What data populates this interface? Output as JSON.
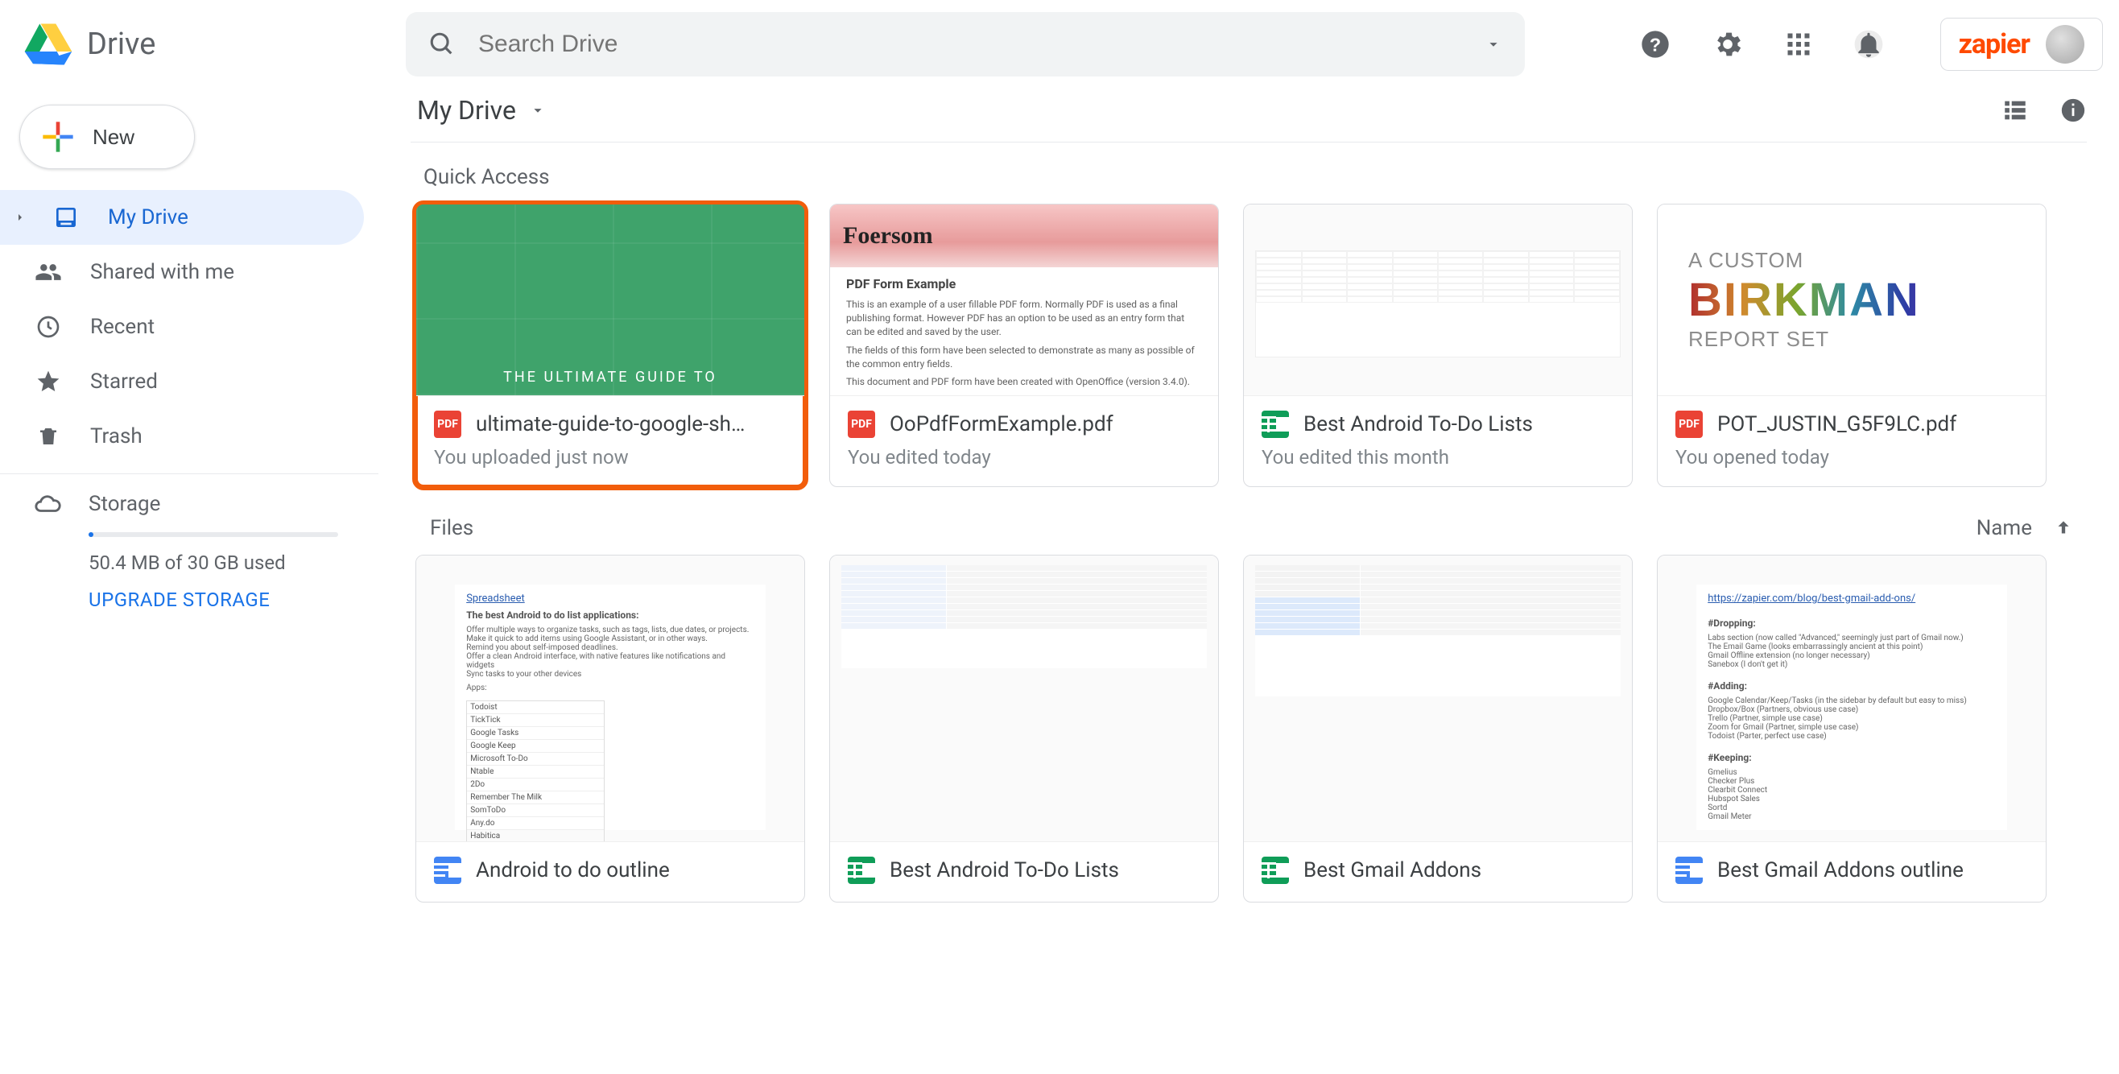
{
  "app": {
    "name": "Drive"
  },
  "search": {
    "placeholder": "Search Drive"
  },
  "brand": {
    "label": "zapier"
  },
  "new_button": {
    "label": "New"
  },
  "nav": {
    "my_drive": "My Drive",
    "shared": "Shared with me",
    "recent": "Recent",
    "starred": "Starred",
    "trash": "Trash",
    "storage": "Storage"
  },
  "storage": {
    "usage": "50.4 MB of 30 GB used",
    "upgrade": "UPGRADE STORAGE"
  },
  "breadcrumb": {
    "root": "My Drive"
  },
  "sections": {
    "quick_access": "Quick Access",
    "files": "Files",
    "sort_label": "Name"
  },
  "quick_access": {
    "items": [
      {
        "title": "ultimate-guide-to-google-sh…",
        "subtitle": "You uploaded just now",
        "icon": "pdf",
        "thumb_text": "THE ULTIMATE GUIDE TO",
        "highlighted": true
      },
      {
        "title": "OoPdfFormExample.pdf",
        "subtitle": "You edited today",
        "icon": "pdf",
        "foersom_title": "Foersom",
        "foersom_h": "PDF Form Example",
        "foersom_p1": "This is an example of a user fillable PDF form. Normally PDF is used as a final publishing format. However PDF has an option to be used as an entry form that can be edited and saved by the user.",
        "foersom_p2": "The fields of this form have been selected to demonstrate as many as possible of the common entry fields.",
        "foersom_p3": "This document and PDF form have been created with OpenOffice (version 3.4.0)."
      },
      {
        "title": "Best Android To-Do Lists",
        "subtitle": "You edited this month",
        "icon": "sheet"
      },
      {
        "title": "POT_JUSTIN_G5F9LC.pdf",
        "subtitle": "You opened today",
        "icon": "pdf",
        "bk1": "A CUSTOM",
        "bk2": "BIRKMAN",
        "bk3": "REPORT SET"
      }
    ]
  },
  "files": {
    "items": [
      {
        "title": "Android to do outline",
        "icon": "doc",
        "td_link": "Spreadsheet",
        "td_head": "The best Android to do list applications:",
        "td_bullets": [
          "Offer multiple ways to organize tasks, such as tags, lists, due dates, or projects.",
          "Make it quick to add items using Google Assistant, or in other ways.",
          "Remind you about self-imposed deadlines.",
          "Offer a clean Android interface, with native features like notifications and widgets",
          "Sync tasks to your other devices"
        ],
        "td_apps_label": "Apps:",
        "td_apps": [
          "Todoist",
          "TickTick",
          "Google Tasks",
          "Google Keep",
          "Microsoft To-Do",
          "Ntable",
          "2Do",
          "Remember The Milk",
          "SomToDo",
          "Any.do",
          "Habitica"
        ]
      },
      {
        "title": "Best Android To-Do Lists",
        "icon": "sheet"
      },
      {
        "title": "Best Gmail Addons",
        "icon": "sheet"
      },
      {
        "title": "Best Gmail Addons outline",
        "icon": "doc",
        "ao_link": "https://zapier.com/blog/best-gmail-add-ons/",
        "ao_head1": "#Dropping:",
        "ao_list1": [
          "Labs section (now called \"Advanced,\" seemingly just part of Gmail now.)",
          "The Email Game (looks embarrassingly ancient at this point)",
          "Gmail Offline extension (no longer necessary)",
          "Sanebox (I don't get it)"
        ],
        "ao_head2": "#Adding:",
        "ao_list2": [
          "Google Calendar/Keep/Tasks (in the sidebar by default but easy to miss)",
          "Dropbox/Box (Partners, obvious use case)",
          "Trello (Partner, simple use case)",
          "Zoom for Gmail (Partner, simple use case)",
          "Todoist (Parter, perfect use case)"
        ],
        "ao_head3": "#Keeping:",
        "ao_list3": [
          "Gmelius",
          "Checker Plus",
          "Clearbit Connect",
          "Hubspot Sales",
          "Sortd",
          "Gmail Meter"
        ]
      }
    ]
  }
}
